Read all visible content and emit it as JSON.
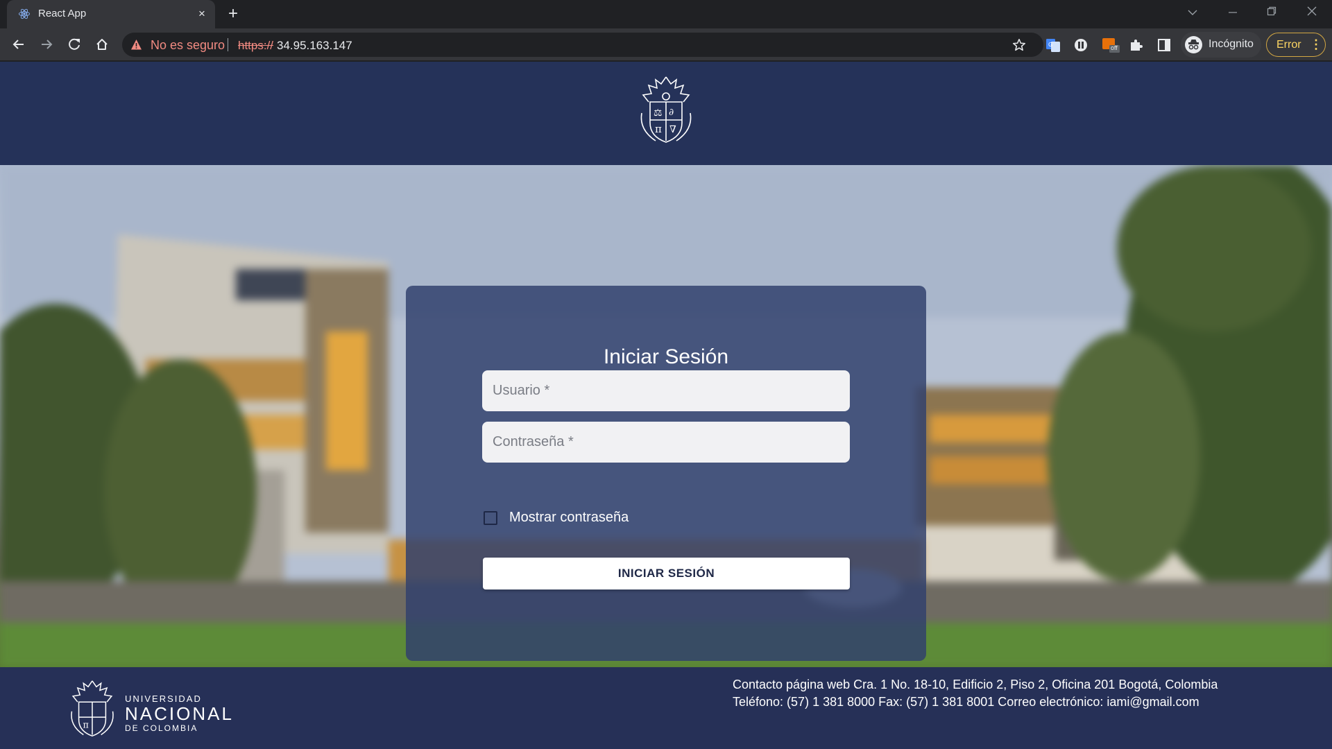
{
  "browser": {
    "tab_title": "React App",
    "tab_close_glyph": "×",
    "new_tab_glyph": "+",
    "security_warning": "No es seguro",
    "url_scheme": "https://",
    "url_host": "34.95.163.147",
    "profile_label": "Incógnito",
    "error_label": "Error",
    "menu_glyph": "⋮",
    "extension_badge": "off",
    "icons": [
      "react-icon",
      "back-icon",
      "forward-icon",
      "reload-icon",
      "home-icon",
      "warning-icon",
      "star-icon",
      "translate-icon",
      "extension-shield-icon",
      "extension-off-icon",
      "puzzle-icon",
      "side-panel-icon",
      "incognito-icon",
      "chevron-down-icon",
      "minimize-icon",
      "restore-icon",
      "close-icon"
    ]
  },
  "login": {
    "title": "Iniciar Sesión",
    "username_placeholder": "Usuario *",
    "password_placeholder": "Contraseña *",
    "show_password_label": "Mostrar contraseña",
    "show_password_checked": false,
    "submit_label": "INICIAR SESIÓN"
  },
  "footer": {
    "brand_line1": "UNIVERSIDAD",
    "brand_line2": "NACIONAL",
    "brand_line3": "DE COLOMBIA",
    "contact_line1": "Contacto página web Cra. 1 No. 18-10, Edificio 2, Piso 2, Oficina 201 Bogotá, Colombia",
    "contact_line2": "Teléfono: (57) 1 381 8000 Fax: (57) 1 381 8001 Correo electrónico: iami@gmail.com"
  },
  "colors": {
    "header_bg": "#253259",
    "footer_bg": "#263057",
    "card_bg": "#31406c",
    "warning": "#f28b82",
    "error_chip": "#fdd663"
  }
}
